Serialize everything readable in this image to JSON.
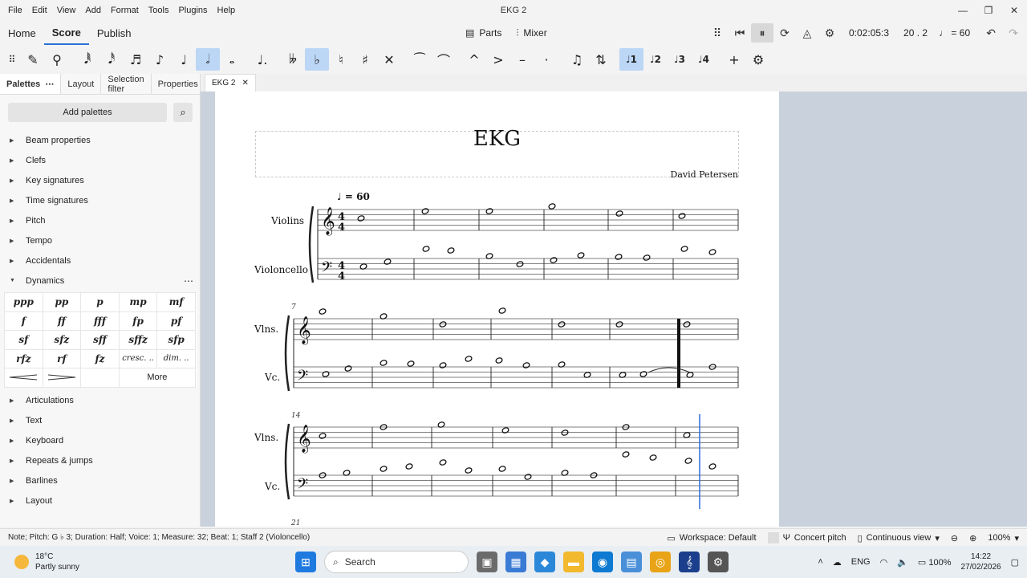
{
  "window": {
    "title": "EKG 2",
    "menu": [
      "File",
      "Edit",
      "View",
      "Add",
      "Format",
      "Tools",
      "Plugins",
      "Help"
    ]
  },
  "main_tabs": [
    "Home",
    "Score",
    "Publish"
  ],
  "center_tools": {
    "parts": "Parts",
    "mixer": "Mixer"
  },
  "playback": {
    "time": "0:02:05:3",
    "position": "20 . 2",
    "tempo": "= 60"
  },
  "left_panel": {
    "tabs": [
      "Palettes",
      "Layout",
      "Selection filter",
      "Properties"
    ],
    "add_palettes": "Add palettes",
    "palettes": [
      "Beam properties",
      "Clefs",
      "Key signatures",
      "Time signatures",
      "Pitch",
      "Tempo",
      "Accidentals",
      "Dynamics"
    ],
    "dynamics": [
      "ppp",
      "pp",
      "p",
      "mp",
      "mf",
      "f",
      "ff",
      "fff",
      "fp",
      "pf",
      "sf",
      "sfz",
      "sff",
      "sffz",
      "sfp",
      "rfz",
      "rf",
      "fz",
      "cresc. ..",
      "dim. .."
    ],
    "more": "More",
    "palettes_after": [
      "Articulations",
      "Text",
      "Keyboard",
      "Repeats & jumps",
      "Barlines",
      "Layout"
    ]
  },
  "document_tab": "EKG 2",
  "score": {
    "title": "EKG",
    "composer": "David Petersen",
    "tempo_marking": "= 60",
    "systems": [
      {
        "top_label": "Violins",
        "bottom_label": "Violoncello",
        "measure_number": ""
      },
      {
        "top_label": "Vlns.",
        "bottom_label": "Vc.",
        "measure_number": "7"
      },
      {
        "top_label": "Vlns.",
        "bottom_label": "Vc.",
        "measure_number": "14"
      }
    ],
    "next_measure_number": "21"
  },
  "status": {
    "text": "Note; Pitch: G ♭ 3; Duration: Half; Voice: 1; Measure: 32; Beat: 1; Staff 2 (Violoncello)",
    "workspace": "Workspace: Default",
    "concert_pitch": "Concert pitch",
    "view_mode": "Continuous view",
    "zoom": "100%"
  },
  "taskbar": {
    "temperature": "18°C",
    "weather": "Partly sunny",
    "search": "Search",
    "language": "ENG",
    "battery": "100%",
    "time": "14:22",
    "date": "27/02/2026"
  },
  "colors": {
    "accent": "#2a6fd6",
    "active_tool": "#bcd6f5",
    "canvas": "#c9d1dc"
  }
}
